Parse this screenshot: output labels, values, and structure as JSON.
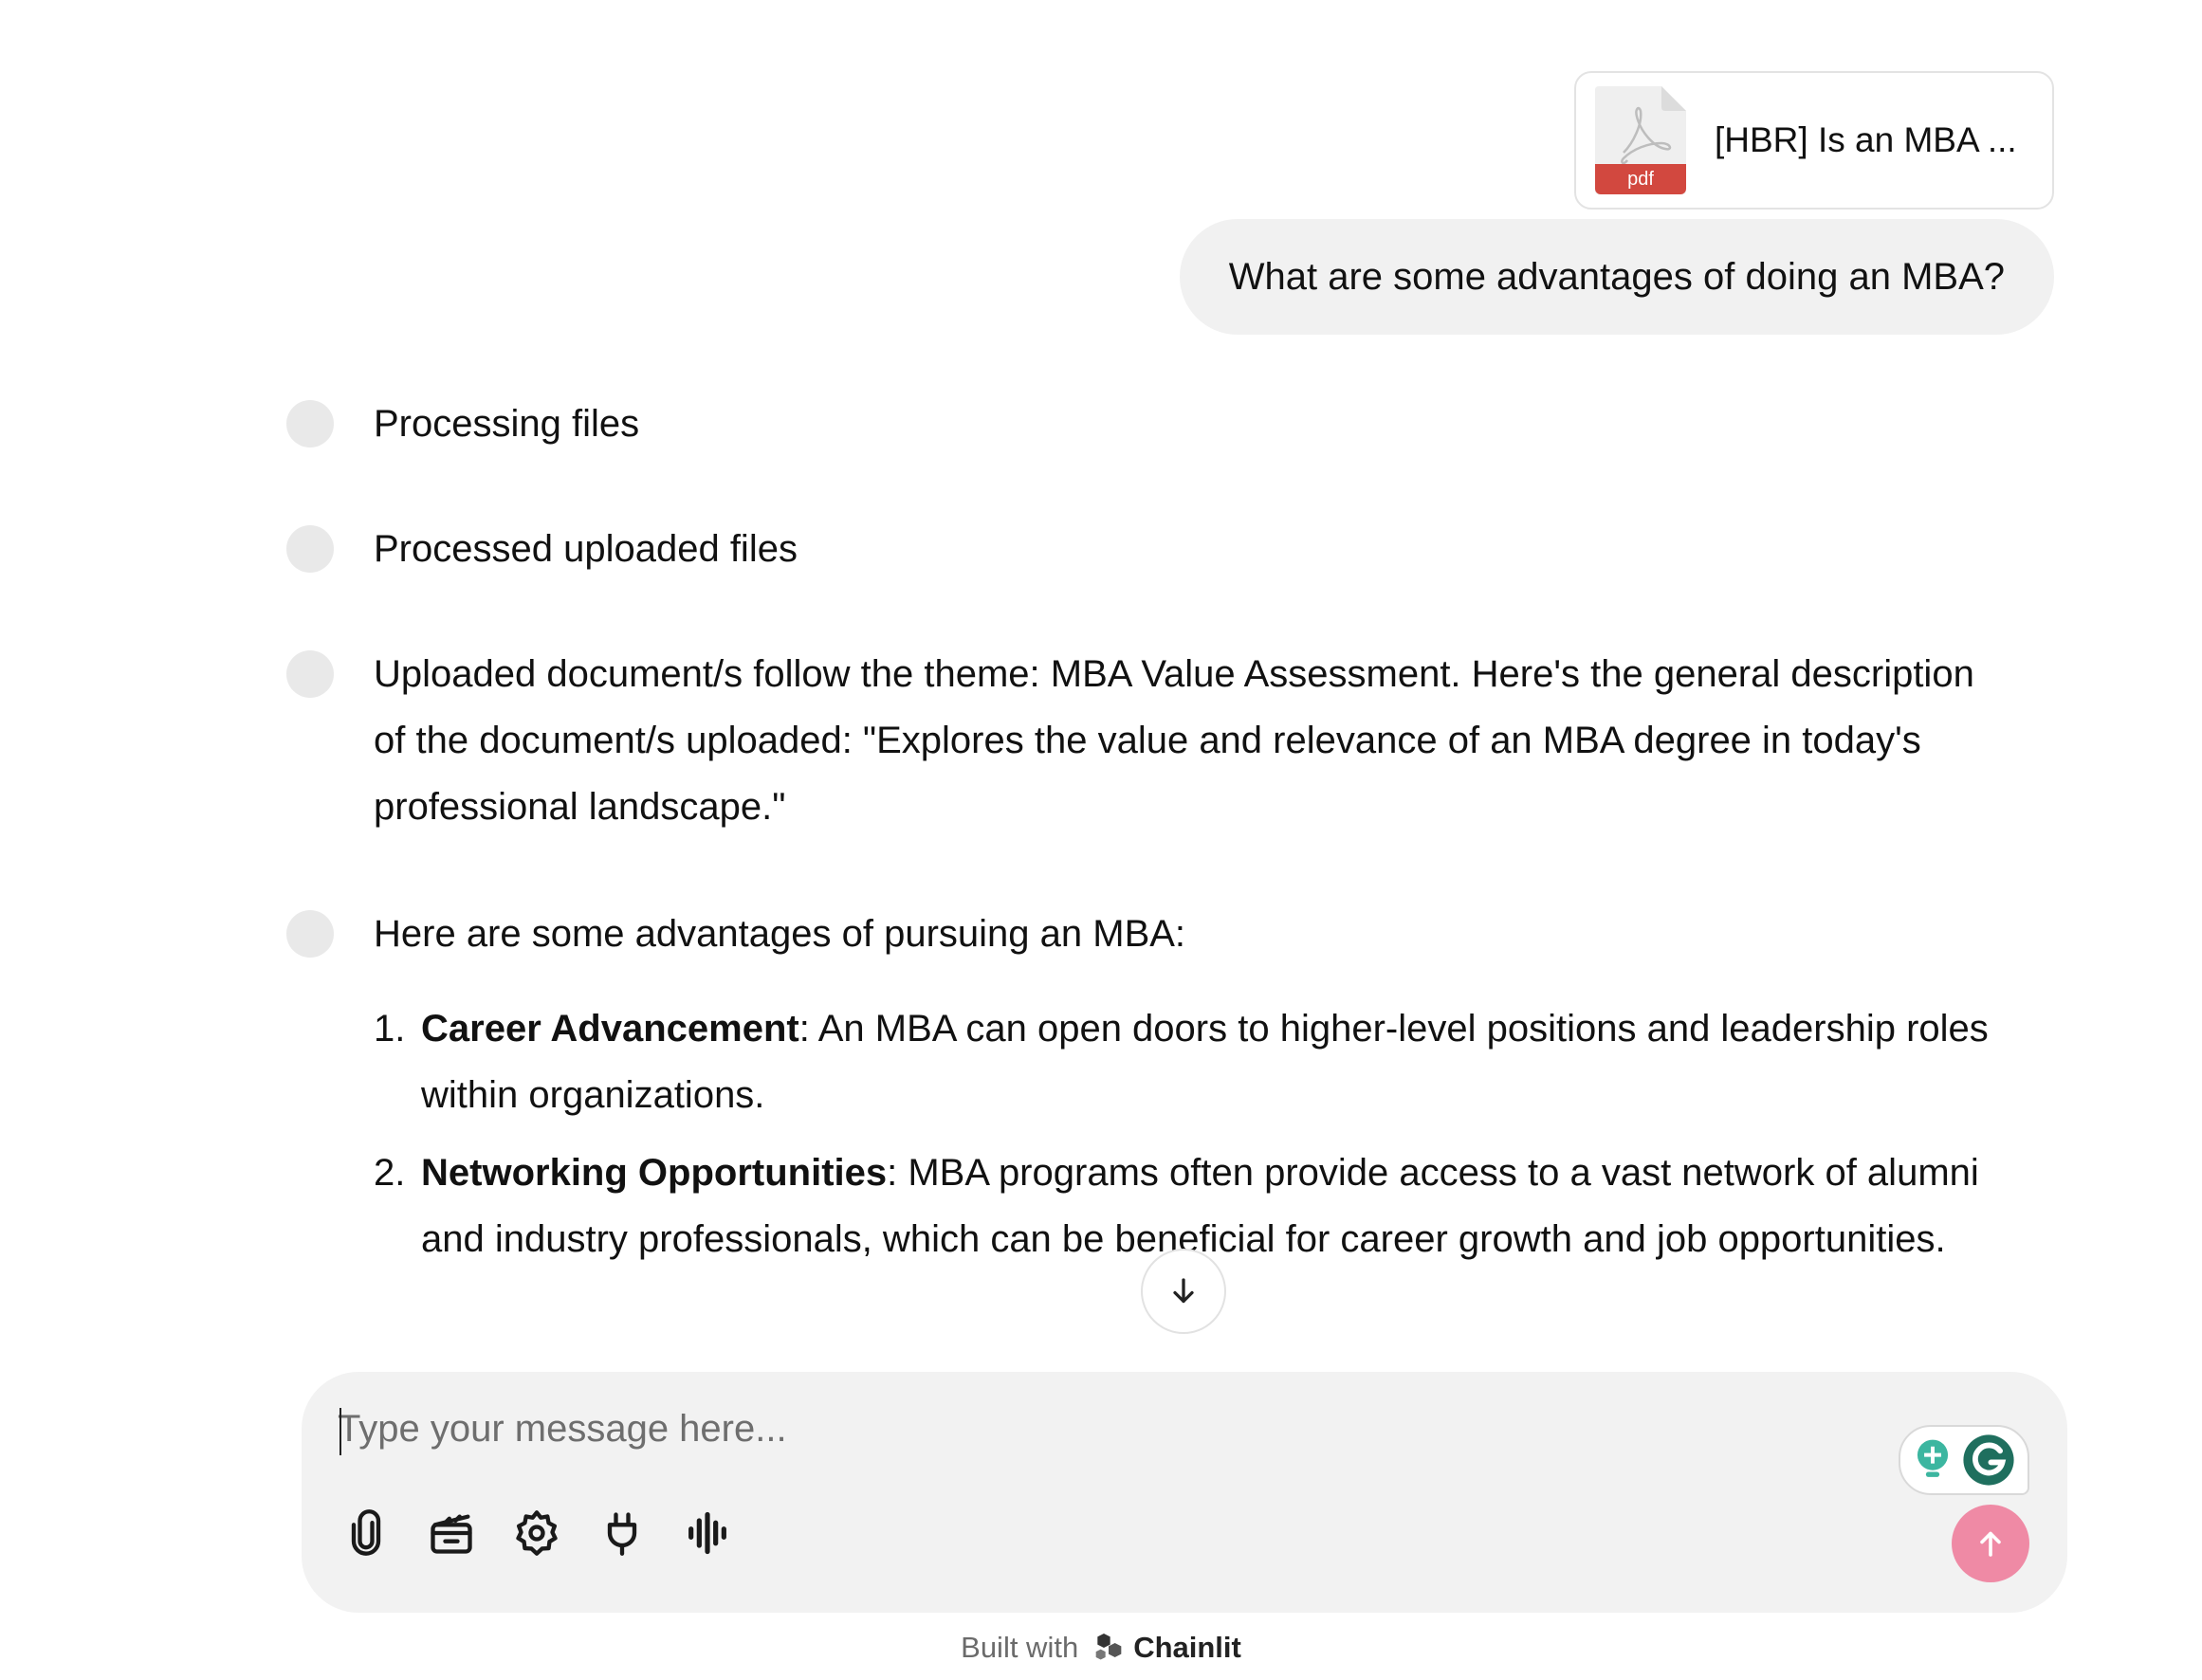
{
  "attachment": {
    "file_type_label": "pdf",
    "file_name": "[HBR] Is an MBA ..."
  },
  "user_message": "What are some advantages of doing an MBA?",
  "steps": [
    {
      "text": "Processing files"
    },
    {
      "text": "Processed uploaded files"
    },
    {
      "text": "Uploaded document/s follow the theme: MBA Value Assessment. Here's the general description of the document/s uploaded: \"Explores the value and relevance of an MBA degree in today's professional landscape.\""
    },
    {
      "text": "Here are some advantages of pursuing an MBA:"
    }
  ],
  "advantages": [
    {
      "num": "1.",
      "title": "Career Advancement",
      "body": ": An MBA can open doors to higher-level positions and leadership roles within organizations."
    },
    {
      "num": "2.",
      "title": "Networking Opportunities",
      "body": ": MBA programs often provide access to a vast network of alumni and industry professionals, which can be beneficial for career growth and job opportunities."
    }
  ],
  "composer": {
    "placeholder": "Type your message here...",
    "value": ""
  },
  "toolbar": {
    "icons": [
      "paperclip-icon",
      "clapperboard-icon",
      "gear-icon",
      "plug-icon",
      "audio-waveform-icon"
    ]
  },
  "footer": {
    "built_with": "Built with",
    "brand": "Chainlit"
  },
  "colors": {
    "send_button": "#ef8aa5",
    "pdf_tag": "#d2483f",
    "bubble_bg": "#f1f1f1",
    "composer_bg": "#f2f2f2"
  }
}
